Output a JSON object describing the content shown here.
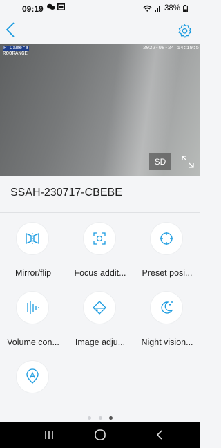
{
  "status": {
    "time": "09:19",
    "battery": "38%"
  },
  "camera": {
    "name_line1": "P Camera",
    "name_line2": "ROORANGE",
    "timestamp": "2022-08-24 14:19:5",
    "sd_label": "SD"
  },
  "device": {
    "name": "SSAH-230717-CBEBE"
  },
  "features": [
    {
      "label": "Mirror/flip",
      "icon": "mirror-flip-icon"
    },
    {
      "label": "Focus addit...",
      "icon": "focus-icon"
    },
    {
      "label": "Preset posi...",
      "icon": "preset-position-icon"
    },
    {
      "label": "Volume con...",
      "icon": "volume-icon"
    },
    {
      "label": "Image adju...",
      "icon": "image-adjust-icon"
    },
    {
      "label": "Night vision...",
      "icon": "night-vision-icon"
    },
    {
      "label": "",
      "icon": "intelligent-tracking-icon"
    }
  ],
  "pager": {
    "pages": 3,
    "active": 2
  },
  "colors": {
    "accent": "#1a9be0",
    "background": "#f4f5f7",
    "navbar": "#000000"
  }
}
